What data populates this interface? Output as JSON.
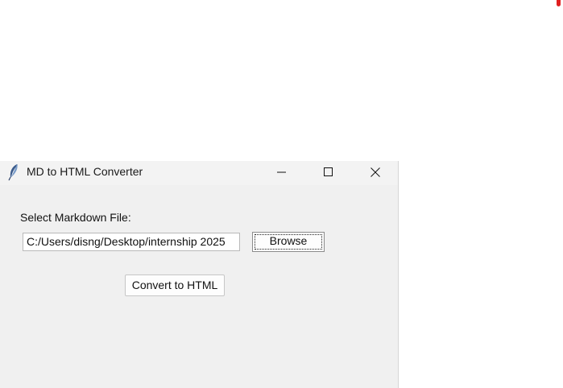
{
  "window": {
    "title": "MD to HTML Converter",
    "icon": "feather-icon"
  },
  "form": {
    "file_label": "Select Markdown File:",
    "file_path_value": "C:/Users/disng/Desktop/internship 2025",
    "browse_label": "Browse",
    "convert_label": "Convert to HTML"
  },
  "colors": {
    "window_bg": "#f0f0f0",
    "titlebar_bg": "#f3f3f3",
    "indicator_dot": "#e02020"
  }
}
